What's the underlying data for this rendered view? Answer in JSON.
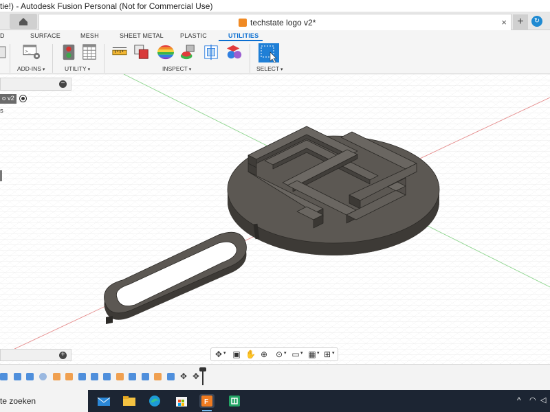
{
  "window": {
    "title": "tie!) - Autodesk Fusion Personal (Not for Commercial Use)",
    "minimize": "—",
    "maximize": "☐"
  },
  "document_tab": {
    "name": "techstate logo v2*",
    "close": "×",
    "icon": "cube-doc-icon"
  },
  "tabbar": {
    "new_tab": "+"
  },
  "ribbon": {
    "tabs": [
      "D",
      "SURFACE",
      "MESH",
      "SHEET METAL",
      "PLASTIC",
      "UTILITIES"
    ],
    "active_tab": "UTILITIES",
    "groups": [
      "ADD-INS",
      "UTILITY",
      "INSPECT",
      "SELECT"
    ]
  },
  "browser": {
    "component_label": "o v2",
    "sub_label": "s"
  },
  "taskbar": {
    "search_text": "te zoeken",
    "tray_up": "^"
  },
  "colors": {
    "accent": "#0a6ed1",
    "model_top": "#5b5752",
    "model_side": "#3f3c38",
    "grid": "#dcdcdc",
    "taskbar": "#1c2533"
  }
}
